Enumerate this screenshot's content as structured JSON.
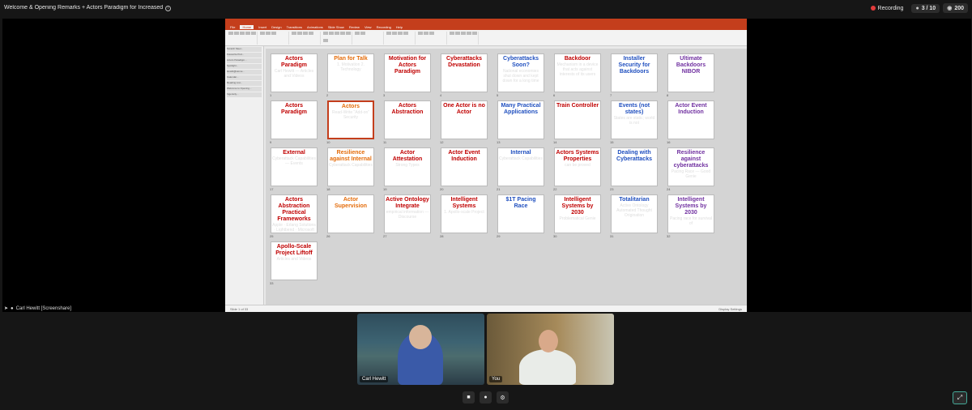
{
  "meeting": {
    "title": "Welcome & Opening Remarks + Actors Paradigm for Increased",
    "recording_label": "Recording",
    "participants_count": "3 / 10",
    "views_count": "200",
    "screenshare_label": "Carl Hewitt [Screenshare]"
  },
  "participants": [
    {
      "name": "Carl Hewitt"
    },
    {
      "name": "You"
    }
  ],
  "slides": [
    {
      "title": "Actors Paradigm",
      "body": "Carl Hewitt — Articles and Videos",
      "num": "1"
    },
    {
      "title": "Plan for Talk",
      "body": "1. Motivation  2. Technology",
      "num": "2"
    },
    {
      "title": "Motivation for Actors Paradigm",
      "body": "",
      "num": "3"
    },
    {
      "title": "Cyberattacks Devastation",
      "body": "",
      "num": "4"
    },
    {
      "title": "Cyberattacks Soon?",
      "body": "National economies shut down and kept down for a long time",
      "num": "5"
    },
    {
      "title": "Backdoor",
      "body": "Mechanism in a device that acts against interests of its users",
      "num": "6"
    },
    {
      "title": "Installer Security for Backdoors",
      "body": "",
      "num": "7"
    },
    {
      "title": "Ultimate Backdoors NIBOR",
      "body": "",
      "num": "8"
    },
    {
      "title": "Actors Paradigm",
      "body": "",
      "num": "9"
    },
    {
      "title": "Actors",
      "body": "Read-Write “Add-on” Security",
      "num": "10"
    },
    {
      "title": "Actors Abstraction",
      "body": "",
      "num": "11"
    },
    {
      "title": "One Actor is no Actor",
      "body": "",
      "num": "12"
    },
    {
      "title": "Many Practical Applications",
      "body": "",
      "num": "13"
    },
    {
      "title": "Train Controller",
      "body": "",
      "num": "14"
    },
    {
      "title": "Events (not states)",
      "body": "States are static; world is not",
      "num": "15"
    },
    {
      "title": "Actor Event Induction",
      "body": "",
      "num": "16"
    },
    {
      "title": "External",
      "body": "Cyberattack Capabilities — Events",
      "num": "17"
    },
    {
      "title": "Resilience against Internal",
      "body": "Cyberattack Capabilities",
      "num": "18"
    },
    {
      "title": "Actor Attestation",
      "body": "Strong Types",
      "num": "19"
    },
    {
      "title": "Actor Event Induction",
      "body": "",
      "num": "20"
    },
    {
      "title": "Internal",
      "body": "Cyberattack Capabilities",
      "num": "21"
    },
    {
      "title": "Actors Systems Properties",
      "body": "can be proved",
      "num": "22"
    },
    {
      "title": "Dealing with Cyberattacks",
      "body": "",
      "num": "23"
    },
    {
      "title": "Resilience against cyberattacks",
      "body": "Pacing Race — Good Genie",
      "num": "24"
    },
    {
      "title": "Actors Abstraction Practical Frameworks",
      "body": "Apple · Erlang Solutions · Lightbend · Microsoft",
      "num": "25"
    },
    {
      "title": "Actor Supervision",
      "body": "",
      "num": "26"
    },
    {
      "title": "Active Ontology Integrate",
      "body": "empirical information — Discourse",
      "num": "27"
    },
    {
      "title": "Intelligent Systems",
      "body": "1. Apollo-scale Project",
      "num": "28"
    },
    {
      "title": "$1T Pacing Race",
      "body": "",
      "num": "29"
    },
    {
      "title": "Intelligent Systems by 2030",
      "body": "Problematical Genie",
      "num": "30"
    },
    {
      "title": "Totalitarian",
      "body": "Active Ontology Automated Thought Origination",
      "num": "31"
    },
    {
      "title": "Intelligent Systems by 2030",
      "body": "Pacing race for survival of",
      "num": "32"
    },
    {
      "title": "Apollo-Scale Project Liftoff",
      "body": "Articles and Videos",
      "num": "33"
    }
  ],
  "sidebar_rows": [
    "Scratch Meet...",
    "Favourite Pod...",
    "Actors Paradigm...",
    "Spotlight...",
    "Hewitt@Home...",
    "Calendar...",
    "Reading List...",
    "Welcome to Opening...",
    "Ingenuity..."
  ],
  "ribbon_tabs": [
    "File",
    "Home",
    "Insert",
    "Design",
    "Transitions",
    "Animations",
    "Slide Show",
    "Review",
    "View",
    "Recording",
    "Help"
  ],
  "status": {
    "left": "Slide 1 of 33",
    "right": "Display Settings"
  }
}
